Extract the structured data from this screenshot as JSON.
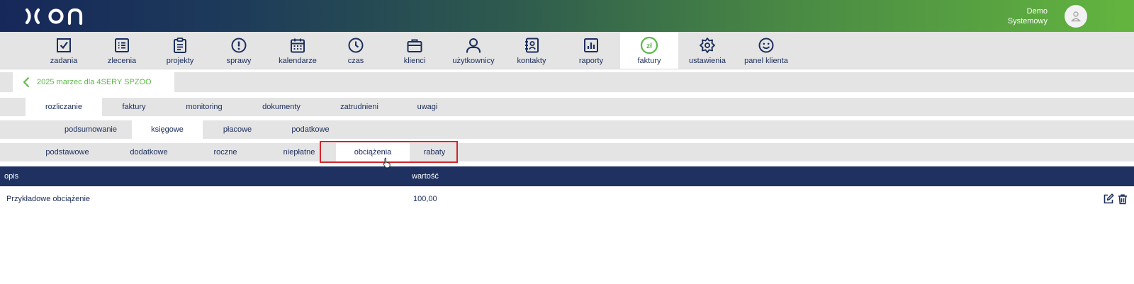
{
  "header": {
    "user_first": "Demo",
    "user_last": "Systemowy",
    "logo_icon": "xon-logo",
    "avatar_icon": "user-avatar-icon"
  },
  "mainnav": {
    "items": [
      {
        "label": "zadania",
        "icon": "checkbox-icon"
      },
      {
        "label": "zlecenia",
        "icon": "list-icon"
      },
      {
        "label": "projekty",
        "icon": "clipboard-icon"
      },
      {
        "label": "sprawy",
        "icon": "exclamation-icon"
      },
      {
        "label": "kalendarze",
        "icon": "calendar-icon"
      },
      {
        "label": "czas",
        "icon": "clock-icon"
      },
      {
        "label": "klienci",
        "icon": "briefcase-icon"
      },
      {
        "label": "użytkownicy",
        "icon": "user-icon"
      },
      {
        "label": "kontakty",
        "icon": "address-book-icon"
      },
      {
        "label": "raporty",
        "icon": "bar-chart-icon"
      },
      {
        "label": "faktury",
        "icon": "zloty-icon",
        "active": true
      },
      {
        "label": "ustawienia",
        "icon": "gear-icon"
      },
      {
        "label": "panel klienta",
        "icon": "smiley-icon"
      }
    ]
  },
  "breadcrumb": {
    "text": "2025 marzec dla 4SERY SPZOO"
  },
  "tabs_level1": {
    "items": [
      "rozliczanie",
      "faktury",
      "monitoring",
      "dokumenty",
      "zatrudnieni",
      "uwagi"
    ],
    "active": "rozliczanie"
  },
  "tabs_level2": {
    "items": [
      "podsumowanie",
      "księgowe",
      "płacowe",
      "podatkowe"
    ],
    "active": "księgowe"
  },
  "tabs_level3": {
    "items": [
      "podstawowe",
      "dodatkowe",
      "roczne",
      "niepłatne",
      "obciążenia",
      "rabaty"
    ],
    "active": "obciążenia"
  },
  "table": {
    "headers": {
      "opis": "opis",
      "wartosc": "wartość"
    },
    "rows": [
      {
        "opis": "Przykładowe obciążenie",
        "wartosc": "100,00"
      }
    ]
  },
  "colors": {
    "navy": "#1e3160",
    "green": "#5cb947",
    "highlight": "#d3262b"
  }
}
